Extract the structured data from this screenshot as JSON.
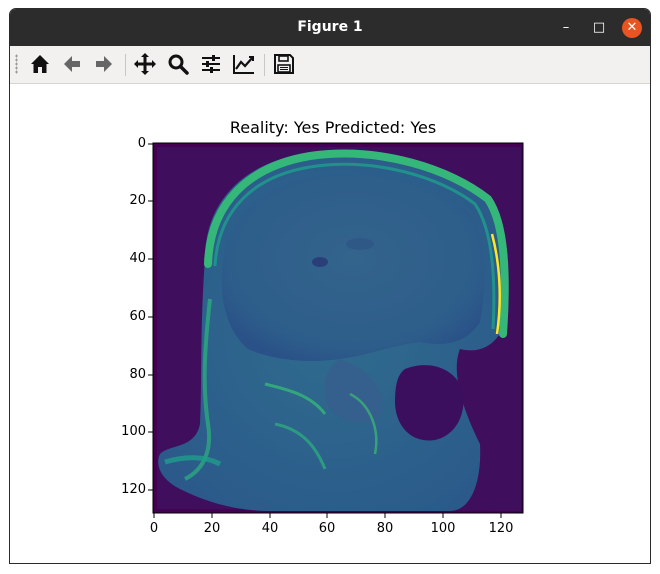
{
  "window": {
    "title": "Figure 1",
    "minimize_glyph": "–",
    "maximize_glyph": "□",
    "close_glyph": "✕"
  },
  "toolbar": {
    "icons": [
      "home-icon",
      "back-arrow-icon",
      "forward-arrow-icon",
      "pan-icon",
      "zoom-icon",
      "configure-subplots-icon",
      "edit-axis-icon",
      "save-icon"
    ]
  },
  "figure": {
    "title": "Reality: Yes Predicted: Yes",
    "y_ticks": [
      "0",
      "20",
      "40",
      "60",
      "80",
      "100",
      "120"
    ],
    "x_ticks": [
      "0",
      "20",
      "40",
      "60",
      "80",
      "100",
      "120"
    ],
    "image_size": [
      128,
      128
    ],
    "colormap": "viridis",
    "colors": {
      "background": "#440154",
      "tissue": "#31688e",
      "bright": "#35b779",
      "highlight": "#fde725"
    }
  }
}
